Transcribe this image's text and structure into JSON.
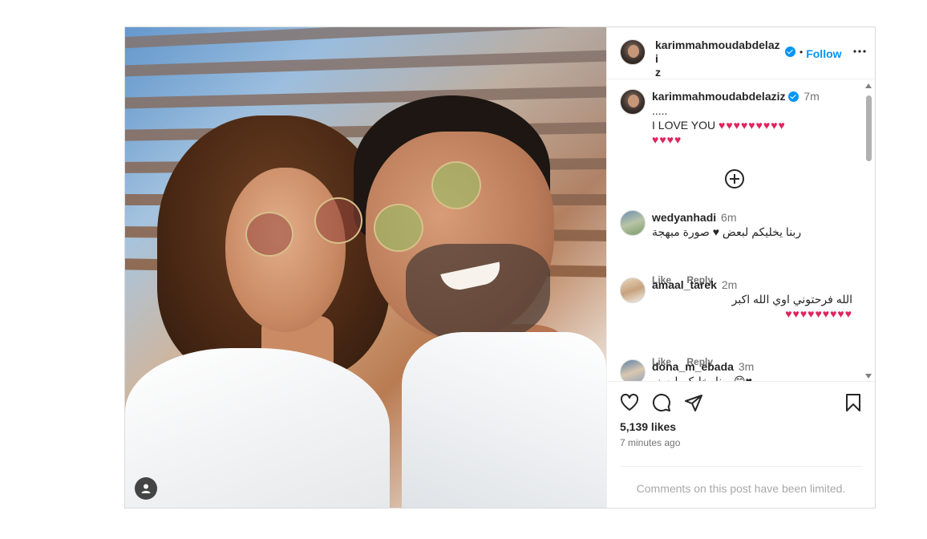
{
  "post": {
    "author": "karimmahmoudabdelaziz",
    "author_wrapped_line1": "karimmahmoudabdelazi",
    "author_wrapped_line2": "z",
    "separator": "•",
    "follow_label": "Follow",
    "more_label": "•••",
    "likes": "5,139 likes",
    "time_ago": "7 minutes ago",
    "comments_limited": "Comments on this post have been limited."
  },
  "caption": {
    "user": "karimmahmoudabdelaziz",
    "time": "7m",
    "line1": ".....",
    "line2": "I LOVE YOU",
    "hearts_line2": "♥♥♥♥♥♥♥♥♥",
    "hearts_line3": "♥♥♥♥"
  },
  "comments": [
    {
      "user": "wedyanhadi",
      "time": "6m",
      "text": "ربنا يخليكم لبعض ♥ صورة مبهجة",
      "like": "Like",
      "reply": "Reply"
    },
    {
      "user": "amaal_tarek",
      "time": "2m",
      "text": "الله فرحتوني اوي الله اكبر",
      "hearts": "♥♥♥♥♥♥♥♥♥",
      "like": "Like",
      "reply": "Reply"
    },
    {
      "user": "dona_m_ebada",
      "time": "3m",
      "text": "♥😊 ربنا يخليكم لبعض"
    }
  ],
  "icons": {
    "like": "heart-icon",
    "comment": "comment-icon",
    "share": "share-icon",
    "save": "bookmark-icon",
    "add_comment": "plus-circle-icon",
    "user_tag": "user-tag-icon"
  },
  "colors": {
    "accent": "#0095f6",
    "heart": "#e0245e",
    "muted": "#737373"
  }
}
